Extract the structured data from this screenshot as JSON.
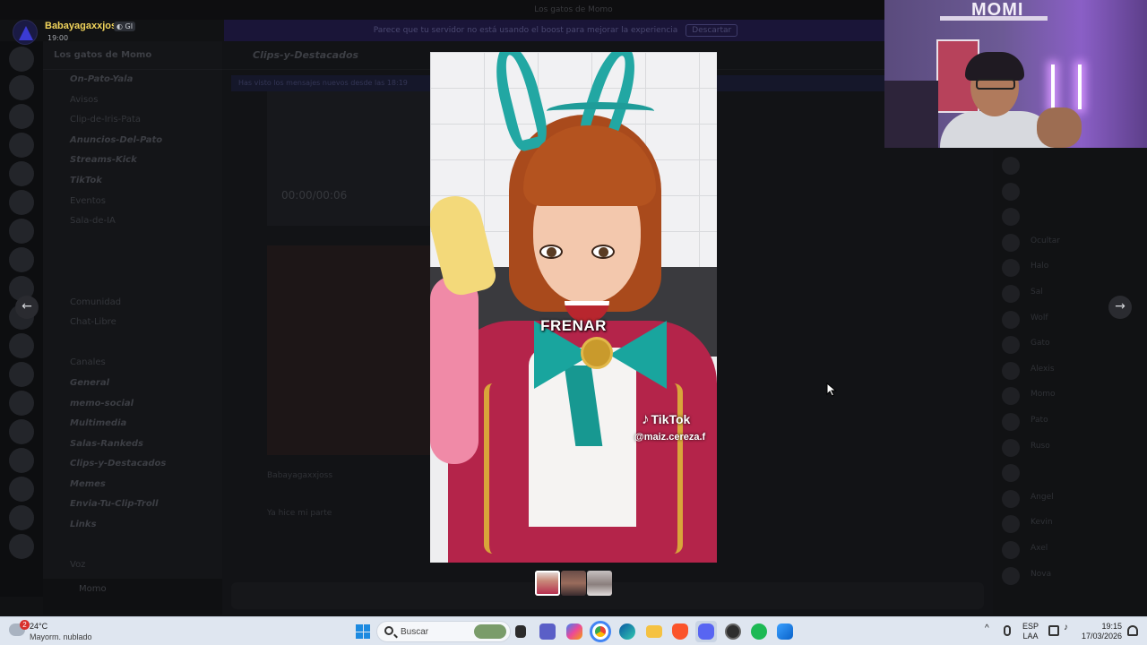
{
  "background": {
    "window_title": "Los gatos de Momo",
    "banner_text": "Parece que tu servidor no está usando el boost para mejorar la experiencia",
    "banner_button": "Descartar",
    "server_name": "Los gatos de Momo",
    "channels": [
      "On-Pato-Yala",
      "Avisos",
      "Clip-de-Iris-Pata",
      "Anuncios-Del-Pato",
      "Streams-Kick",
      "TikTok",
      "Eventos",
      "Sala-de-IA",
      "",
      "",
      "",
      "Comunidad",
      "Chat-Libre",
      "",
      "Canales",
      "General",
      "memo-social",
      "Multimedia",
      "Salas-Rankeds",
      "Clips-y-Destacados",
      "Memes",
      "Envia-Tu-Clip-Troll",
      "Links",
      "",
      "Voz",
      "Canal-Voz"
    ],
    "current_user": "Momo",
    "chat_channel": "Clips-y-Destacados",
    "chat_notice": "Has visto los mensajes nuevos desde las 18:19",
    "video_time": "00:00/00:06",
    "message_1": "Babayagaxxjoss",
    "message_2": "Ya hice mi parte",
    "members": [
      "",
      "",
      "",
      "Ocultar",
      "Halo",
      "Sal",
      "Wolf",
      "Gato",
      "Alexis",
      "Momo",
      "Pato",
      "Ruso",
      "",
      "Angel",
      "Kevin",
      "Axel",
      "Nova",
      "",
      ""
    ]
  },
  "viewer": {
    "author": "Babayagaxxjoss",
    "author_tag": "GI",
    "timestamp": "19:00",
    "prev_icon": "arrow-left-icon",
    "next_icon": "arrow-right-icon",
    "caption": "FRENAR",
    "watermark_brand": "TikTok",
    "watermark_handle": "@maiz.cereza.f",
    "thumbnail_count": 3,
    "selected_thumbnail": 1
  },
  "webcam": {
    "wall_sign": "MOMI"
  },
  "taskbar": {
    "weather_temp": "24°C",
    "weather_desc": "Mayorm. nublado",
    "weather_badge": "2",
    "search_placeholder": "Buscar",
    "apps": [
      "file-explorer-icon",
      "teams-icon",
      "copilot-icon",
      "chrome-icon",
      "edge-icon",
      "folder-icon",
      "brave-icon",
      "discord-icon",
      "obs-icon",
      "spotify-icon",
      "store-icon"
    ],
    "lang_top": "ESP",
    "lang_bottom": "LAA",
    "time": "19:15",
    "date": "17/03/2026"
  },
  "colors": {
    "accent_name": "#f2d55c",
    "taskbar": "#dfe6f0",
    "discord_blurple": "#5865f2"
  }
}
